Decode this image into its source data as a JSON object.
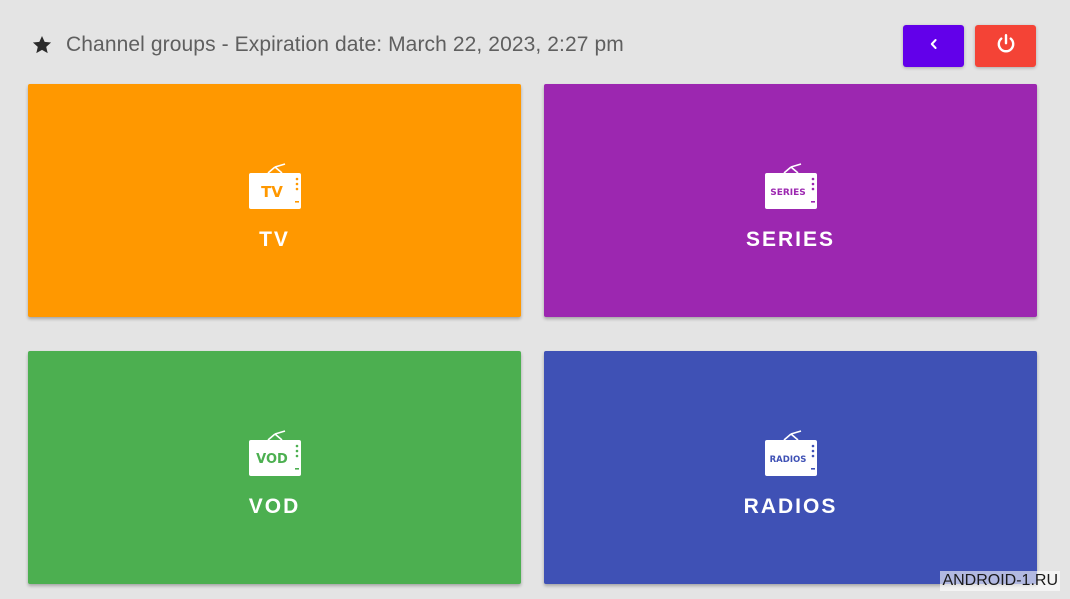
{
  "header": {
    "icon": "star-icon",
    "title": "Channel groups - Expiration date: March 22, 2023, 2:27 pm"
  },
  "buttons": {
    "back": {
      "icon": "chevron-left-icon",
      "color": "#6200ea"
    },
    "power": {
      "icon": "power-icon",
      "color": "#f44336"
    }
  },
  "tiles": [
    {
      "label": "TV",
      "icon_text": "TV",
      "icon": "tv-icon",
      "color": "#ff9800"
    },
    {
      "label": "SERIES",
      "icon_text": "SERIES",
      "icon": "tv-icon",
      "color": "#9c27b0"
    },
    {
      "label": "VOD",
      "icon_text": "VOD",
      "icon": "tv-icon",
      "color": "#4caf50"
    },
    {
      "label": "RADIOS",
      "icon_text": "RADIOS",
      "icon": "tv-icon",
      "color": "#3f51b5"
    }
  ],
  "watermark": "ANDROID-1.RU"
}
